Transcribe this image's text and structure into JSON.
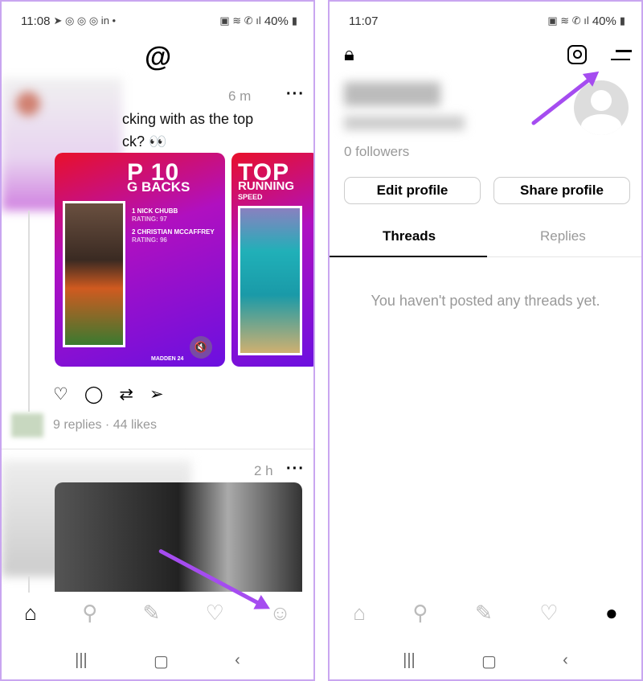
{
  "left": {
    "status": {
      "time": "11:08",
      "battery": "40%"
    },
    "post1": {
      "time": "6 m",
      "text_line1": "cking with as the top",
      "text_line2": "ck? 👀",
      "card1": {
        "title": "P 10",
        "subtitle": "G BACKS",
        "items": [
          "1  NICK CHUBB",
          "RATING: 97",
          "2  CHRISTIAN MCCAFFREY",
          "RATING: 96"
        ],
        "brand": "MADDEN 24"
      },
      "card2": {
        "title": "TOP",
        "subtitle": "RUNNING",
        "label": "SPEED"
      },
      "stats": "9 replies · 44 likes"
    },
    "post2": {
      "time": "2 h"
    },
    "nav": [
      "home-icon",
      "search-icon",
      "compose-icon",
      "heart-icon",
      "profile-icon"
    ],
    "active_nav": "home"
  },
  "right": {
    "status": {
      "time": "11:07",
      "battery": "40%"
    },
    "followers": "0 followers",
    "edit_profile": "Edit profile",
    "share_profile": "Share profile",
    "tabs": [
      "Threads",
      "Replies"
    ],
    "active_tab": "Threads",
    "empty_message": "You haven't posted any threads yet.",
    "active_nav": "profile"
  },
  "colors": {
    "annotation_arrow": "#a54cf0",
    "frame": "#c9a6f0"
  }
}
